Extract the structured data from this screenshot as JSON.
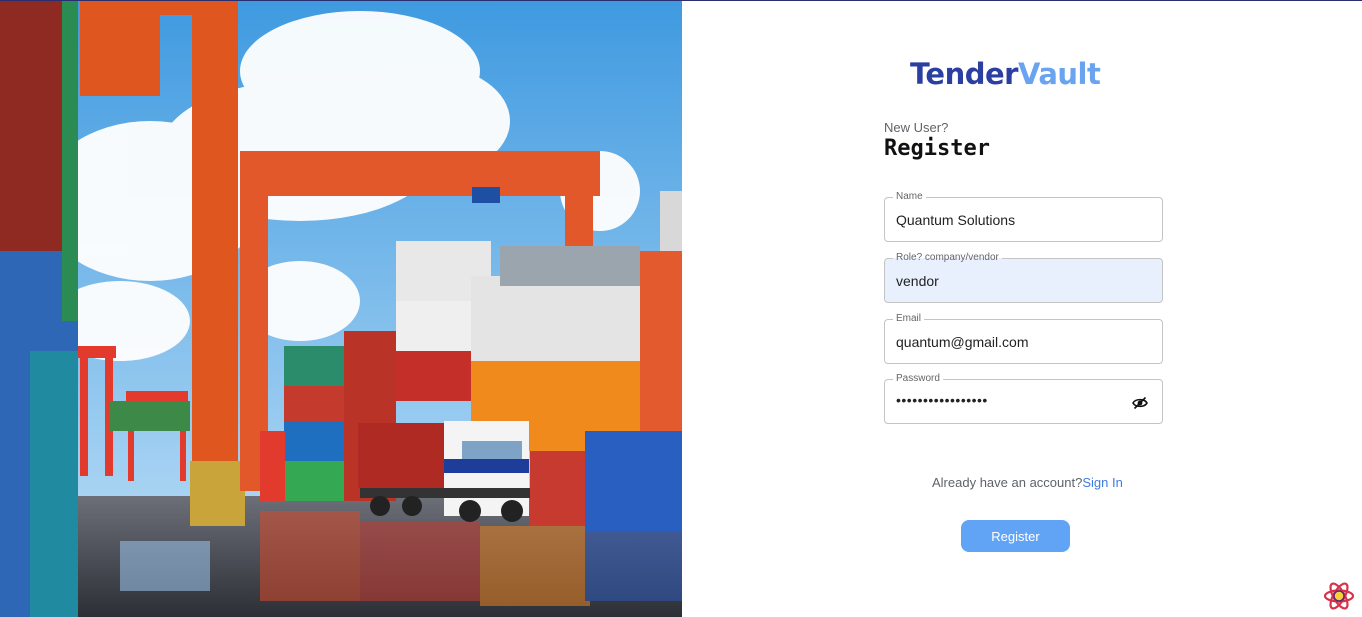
{
  "brand": {
    "part1": "Tender",
    "part2": "Vault"
  },
  "form": {
    "eyebrow": "New User?",
    "title": "Register",
    "fields": {
      "name": {
        "label": "Name",
        "value": "Quantum Solutions"
      },
      "role": {
        "label": "Role? company/vendor",
        "value": "vendor"
      },
      "email": {
        "label": "Email",
        "value": "quantum@gmail.com"
      },
      "password": {
        "label": "Password",
        "value": "•••••••••••••••••"
      }
    },
    "signin_prompt": "Already have an account?",
    "signin_link": "Sign In",
    "submit_label": "Register"
  },
  "icons": {
    "password_toggle": "eye-off-icon",
    "dev_badge": "react-atom-icon"
  },
  "colors": {
    "brand_dark": "#2b3fa0",
    "brand_light": "#6aa3ef",
    "button": "#61a4f6",
    "autofill_bg": "#e8f0fe",
    "link": "#3d7de0"
  }
}
